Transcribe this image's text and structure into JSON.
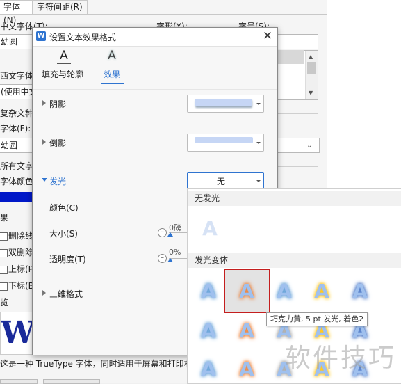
{
  "background": {
    "tabs": [
      "字体(N)",
      "字符间距(R)"
    ],
    "labels": {
      "chinese_font": "中文字体(T):",
      "style": "字形(Y):",
      "size": "字号(S):",
      "western_font": "西文字体(",
      "complex_font": "复杂文种",
      "font": "字体(F):",
      "all_text": "所有文字",
      "font_color": "字体颜色(",
      "effects": "果",
      "preview": "览"
    },
    "values": {
      "chinese_font_value": "幼圆",
      "western_font_value": "(使用中文",
      "font_value": "幼圆"
    },
    "checkboxes": [
      "删除线",
      "双删除",
      "上标(P",
      "下标(B"
    ],
    "preview_sample": "WF",
    "description": "这是一种 TrueType 字体，同时适用于屏幕和打印机"
  },
  "dialog": {
    "title": "设置文本效果格式",
    "close_glyph": "✕",
    "app_icon_glyph": "W",
    "tabs": [
      {
        "label": "填充与轮廓",
        "icon_glyph": "A"
      },
      {
        "label": "效果",
        "icon_glyph": "A"
      }
    ],
    "sections": {
      "shadow": "阴影",
      "reflection": "倒影",
      "glow": "发光",
      "three_d": "三维格式"
    },
    "glow_value": "无",
    "glow_options": {
      "color_label": "颜色(C)",
      "size_label": "大小(S)",
      "size_value": "0磅",
      "transparency_label": "透明度(T)",
      "transparency_value": "0%"
    }
  },
  "glow_panel": {
    "no_glow_header": "无发光",
    "variants_header": "发光变体",
    "sample_glyph": "A",
    "tooltip": "巧克力黄, 5 pt 发光, 着色2",
    "colors": {
      "blue": "#5b9bd5",
      "orange": "#ed7d31",
      "gray": "#a5a5a5",
      "gold": "#ffc000",
      "blue2": "#4472c4",
      "green": "#70ad47",
      "accent": "#2f74d0",
      "selection": "#c41e1e"
    }
  },
  "watermark": "软件技巧"
}
